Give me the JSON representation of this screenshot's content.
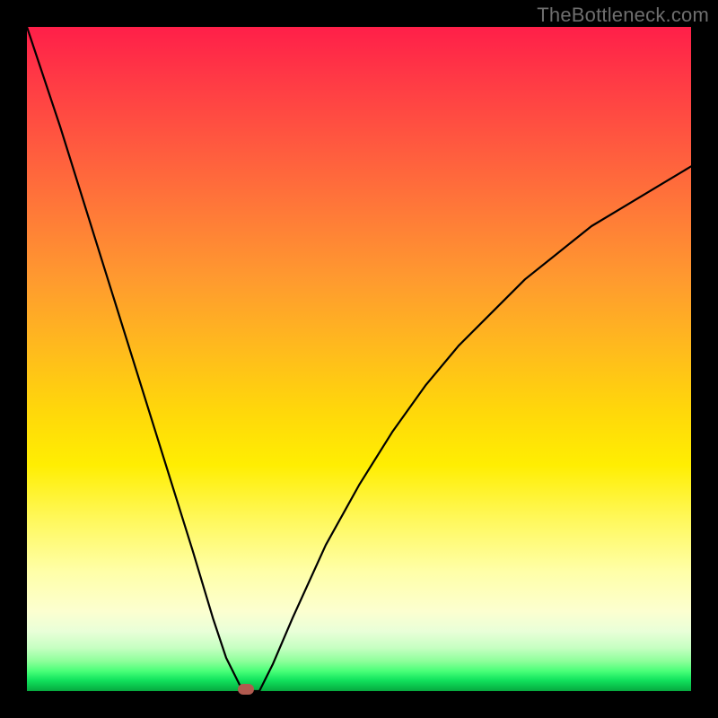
{
  "watermark": "TheBottleneck.com",
  "colors": {
    "frame": "#000000",
    "curve": "#000000",
    "marker": "#b15a4f"
  },
  "chart_data": {
    "type": "line",
    "title": "",
    "xlabel": "",
    "ylabel": "",
    "xlim": [
      0,
      100
    ],
    "ylim": [
      0,
      100
    ],
    "grid": false,
    "series": [
      {
        "name": "bottleneck-curve",
        "x": [
          0,
          5,
          10,
          15,
          20,
          25,
          28,
          30,
          32,
          33,
          34,
          35,
          37,
          40,
          45,
          50,
          55,
          60,
          65,
          70,
          75,
          80,
          85,
          90,
          95,
          100
        ],
        "values": [
          100,
          85,
          69,
          53,
          37,
          21,
          11,
          5,
          1,
          0,
          0,
          0,
          4,
          11,
          22,
          31,
          39,
          46,
          52,
          57,
          62,
          66,
          70,
          73,
          76,
          79
        ]
      }
    ],
    "annotations": [
      {
        "name": "optimal-marker",
        "x": 33,
        "y": 0
      }
    ],
    "background_gradient": "red-yellow-green vertical (high=red top, low=green bottom)"
  }
}
